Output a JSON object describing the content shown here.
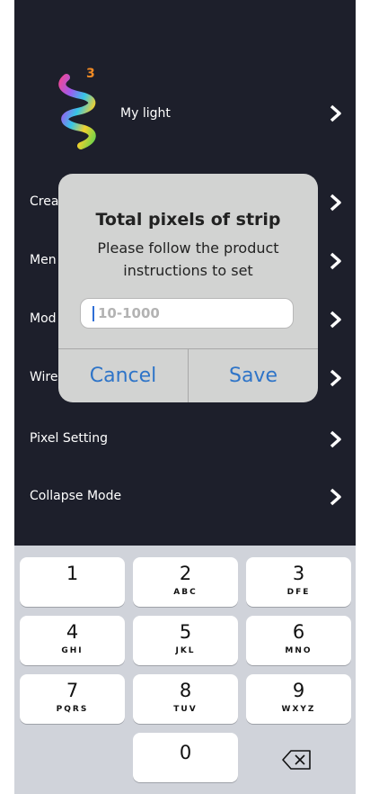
{
  "device": {
    "name": "My light",
    "count": "3"
  },
  "menu": {
    "items": [
      {
        "label": "Crea"
      },
      {
        "label": "Men"
      },
      {
        "label": "Mod"
      },
      {
        "label": "Wire"
      },
      {
        "label": "Pixel Setting"
      },
      {
        "label": "Collapse Mode"
      }
    ]
  },
  "dialog": {
    "title": "Total pixels of strip",
    "message": "Please follow the product instructions to set",
    "input_placeholder": "10-1000",
    "cancel_label": "Cancel",
    "save_label": "Save"
  },
  "keypad": {
    "keys": [
      {
        "num": "1",
        "letters": ""
      },
      {
        "num": "2",
        "letters": "ABC"
      },
      {
        "num": "3",
        "letters": "DFE"
      },
      {
        "num": "4",
        "letters": "GHI"
      },
      {
        "num": "5",
        "letters": "JKL"
      },
      {
        "num": "6",
        "letters": "MNO"
      },
      {
        "num": "7",
        "letters": "PQRS"
      },
      {
        "num": "8",
        "letters": "TUV"
      },
      {
        "num": "9",
        "letters": "WXYZ"
      },
      {
        "num": "0",
        "letters": ""
      }
    ]
  },
  "colors": {
    "background": "#1d1f2b",
    "accent": "#2e74c8",
    "badge": "#f08a24"
  }
}
